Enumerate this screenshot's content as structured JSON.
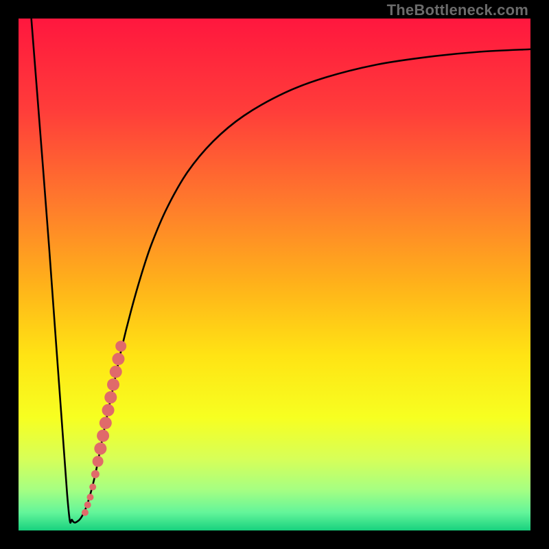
{
  "watermark": {
    "text": "TheBottleneck.com"
  },
  "colors": {
    "frame": "#000000",
    "gradient_stops": [
      {
        "offset": 0.0,
        "color": "#ff173e"
      },
      {
        "offset": 0.18,
        "color": "#ff3d3a"
      },
      {
        "offset": 0.36,
        "color": "#ff7a2c"
      },
      {
        "offset": 0.52,
        "color": "#ffb21a"
      },
      {
        "offset": 0.66,
        "color": "#ffe414"
      },
      {
        "offset": 0.78,
        "color": "#f7ff21"
      },
      {
        "offset": 0.86,
        "color": "#d7ff58"
      },
      {
        "offset": 0.92,
        "color": "#a6ff82"
      },
      {
        "offset": 0.965,
        "color": "#63f59a"
      },
      {
        "offset": 1.0,
        "color": "#18d17e"
      }
    ],
    "curve": "#000000",
    "marker": "#e06a6a"
  },
  "chart_data": {
    "type": "line",
    "title": "",
    "xlabel": "",
    "ylabel": "",
    "xlim": [
      0,
      100
    ],
    "ylim": [
      0,
      100
    ],
    "grid": false,
    "legend": false,
    "series": [
      {
        "name": "bottleneck-curve",
        "x": [
          2.5,
          6.0,
          9.5,
          10.5,
          11.8,
          13.0,
          14.0,
          15.0,
          16.0,
          17.0,
          18.5,
          20.0,
          22.0,
          24.0,
          26.0,
          29.0,
          33.0,
          38.0,
          44.0,
          52.0,
          60.0,
          70.0,
          80.0,
          90.0,
          100.0
        ],
        "y": [
          100.0,
          55.0,
          7.0,
          2.0,
          2.0,
          4.0,
          7.0,
          11.0,
          16.0,
          21.0,
          28.0,
          35.0,
          43.0,
          50.0,
          56.0,
          63.0,
          70.0,
          76.0,
          81.0,
          85.5,
          88.5,
          91.0,
          92.5,
          93.5,
          94.0
        ]
      }
    ],
    "markers": {
      "name": "data-points",
      "points": [
        {
          "x": 13.0,
          "y": 3.5,
          "r": 5
        },
        {
          "x": 13.5,
          "y": 5.0,
          "r": 5
        },
        {
          "x": 14.0,
          "y": 6.5,
          "r": 5
        },
        {
          "x": 14.5,
          "y": 8.5,
          "r": 5
        },
        {
          "x": 15.0,
          "y": 11.0,
          "r": 6
        },
        {
          "x": 15.5,
          "y": 13.5,
          "r": 8
        },
        {
          "x": 16.0,
          "y": 16.0,
          "r": 9
        },
        {
          "x": 16.5,
          "y": 18.5,
          "r": 9
        },
        {
          "x": 17.0,
          "y": 21.0,
          "r": 9
        },
        {
          "x": 17.5,
          "y": 23.5,
          "r": 9
        },
        {
          "x": 18.0,
          "y": 26.0,
          "r": 9
        },
        {
          "x": 18.5,
          "y": 28.5,
          "r": 9
        },
        {
          "x": 19.0,
          "y": 31.0,
          "r": 9
        },
        {
          "x": 19.5,
          "y": 33.5,
          "r": 9
        },
        {
          "x": 20.0,
          "y": 36.0,
          "r": 8
        }
      ]
    }
  }
}
